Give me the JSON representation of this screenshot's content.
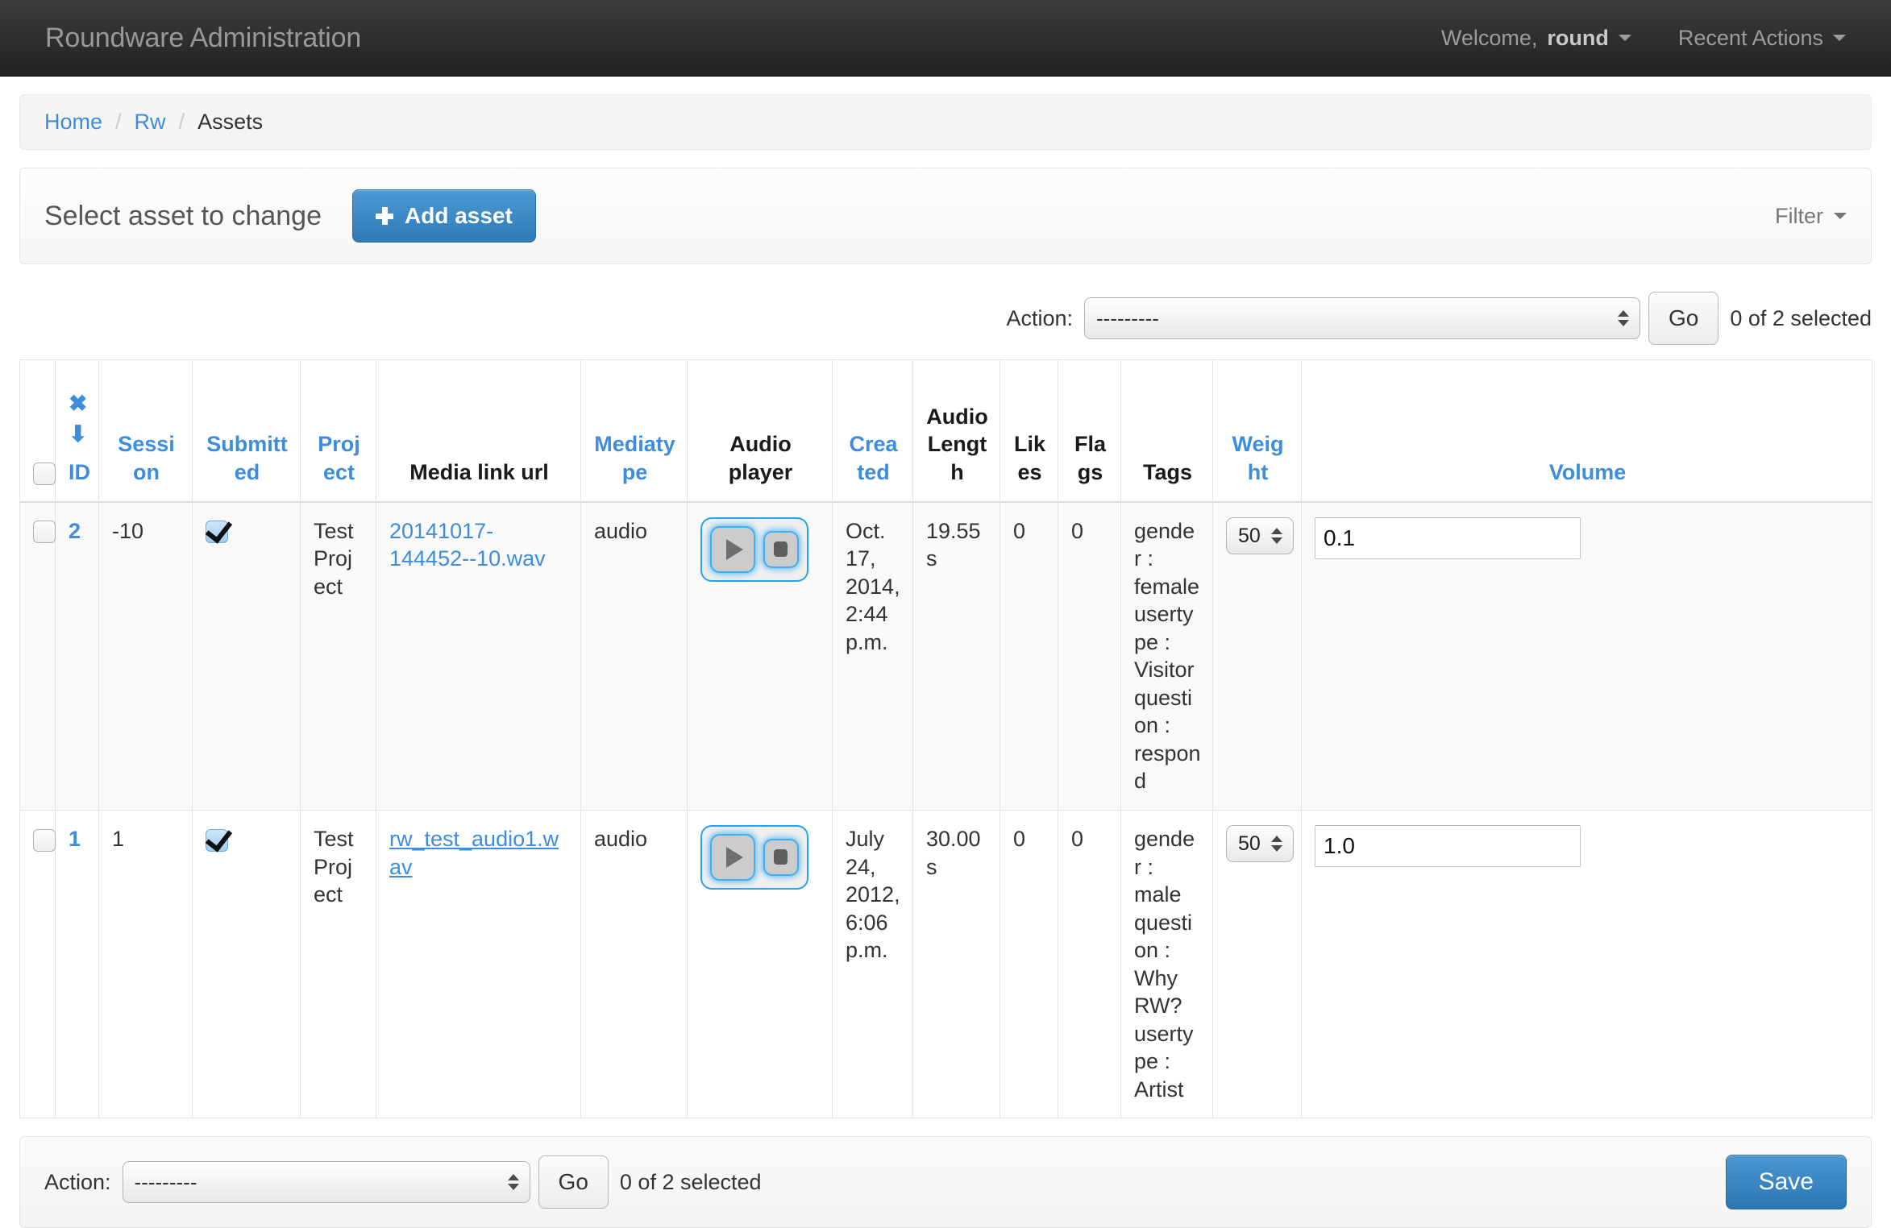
{
  "navbar": {
    "brand": "Roundware Administration",
    "welcome_prefix": "Welcome, ",
    "username": "round",
    "recent_actions": "Recent Actions"
  },
  "breadcrumb": {
    "home": "Home",
    "app": "Rw",
    "current": "Assets",
    "separator": "/"
  },
  "title_panel": {
    "page_title": "Select asset to change",
    "add_button": "Add asset",
    "add_icon": "plus-icon",
    "filter_label": "Filter",
    "filter_icon": "caret-down-icon"
  },
  "actions_top": {
    "label": "Action:",
    "selected_option": "---------",
    "options": [
      "---------"
    ],
    "go_label": "Go",
    "selection_count": "0 of 2 selected"
  },
  "actions_bottom": {
    "label": "Action:",
    "selected_option": "---------",
    "options": [
      "---------"
    ],
    "go_label": "Go",
    "selection_count": "0 of 2 selected",
    "save_label": "Save"
  },
  "table": {
    "sort_remove_icon": "✖",
    "sort_desc_icon": "⬇",
    "headers": [
      {
        "label": "",
        "sortable": false
      },
      {
        "label": "ID",
        "sortable": true
      },
      {
        "label": "Session",
        "sortable": true
      },
      {
        "label": "Submitted",
        "sortable": true
      },
      {
        "label": "Project",
        "sortable": true
      },
      {
        "label": "Media link url",
        "sortable": false
      },
      {
        "label": "Mediatype",
        "sortable": true
      },
      {
        "label": "Audio player",
        "sortable": false
      },
      {
        "label": "Created",
        "sortable": true
      },
      {
        "label": "Audio Length",
        "sortable": false
      },
      {
        "label": "Likes",
        "sortable": false
      },
      {
        "label": "Flags",
        "sortable": false
      },
      {
        "label": "Tags",
        "sortable": false
      },
      {
        "label": "Weight",
        "sortable": true
      },
      {
        "label": "Volume",
        "sortable": true
      }
    ],
    "rows": [
      {
        "selected": false,
        "id": "2",
        "session": "-10",
        "submitted": true,
        "project": "Test Project",
        "media_link": "20141017-144452--10.wav",
        "media_link_underlined": false,
        "mediatype": "audio",
        "audio_player": {
          "play_icon": "play-icon",
          "stop_icon": "stop-icon"
        },
        "created": "Oct. 17, 2014, 2:44 p.m.",
        "audio_length": "19.55 s",
        "likes": "0",
        "flags": "0",
        "tags": "gender : female usertype : Visitor question : respond",
        "weight": "50",
        "volume": "0.1"
      },
      {
        "selected": false,
        "id": "1",
        "session": "1",
        "submitted": true,
        "project": "Test Project",
        "media_link": "rw_test_audio1.wav",
        "media_link_underlined": true,
        "mediatype": "audio",
        "audio_player": {
          "play_icon": "play-icon",
          "stop_icon": "stop-icon"
        },
        "created": "July 24, 2012, 6:06 p.m.",
        "audio_length": "30.00 s",
        "likes": "0",
        "flags": "0",
        "tags": "gender : male question : Why RW? usertype : Artist",
        "weight": "50",
        "volume": "1.0"
      }
    ]
  },
  "colors": {
    "link_blue": "#3c8dde",
    "primary_button": "#2f7ab8",
    "navbar_dark": "#222222",
    "focus_ring": "#29a3f0"
  }
}
